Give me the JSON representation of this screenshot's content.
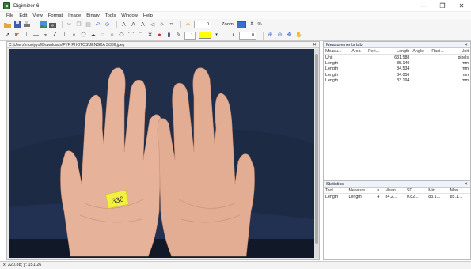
{
  "window": {
    "title": "Digimizer 6",
    "minimize": "—",
    "maximize": "❐",
    "close": "✕"
  },
  "menu": [
    "File",
    "Edit",
    "View",
    "Format",
    "Image",
    "Binary",
    "Tools",
    "Window",
    "Help"
  ],
  "toolbar": {
    "spin1_value": "0",
    "spin2_value": "0",
    "zoom_label": "Zoom:",
    "zoom_pct": "%",
    "spin3_value": "1",
    "spin4_value": "0"
  },
  "image_panel": {
    "path": "C:\\Users\\muniyyof\\Downloads\\FYP PHOTOS\\JENGKA 3\\336.jpeg",
    "close": "✕",
    "sticker_text": "336"
  },
  "measurements": {
    "title": "Measurements tab",
    "close": "✕",
    "columns": [
      "Measu...",
      "Area",
      "Peri...",
      "Length",
      "Angle",
      "Radi...",
      "Unit"
    ],
    "rows": [
      [
        "Unit",
        "",
        "",
        "631.588",
        "",
        "",
        "pixels"
      ],
      [
        "Length",
        "",
        "",
        "85.140",
        "",
        "",
        "mm"
      ],
      [
        "Length",
        "",
        "",
        "84.534",
        "",
        "",
        "mm"
      ],
      [
        "Length",
        "",
        "",
        "84.056",
        "",
        "",
        "mm"
      ],
      [
        "Length",
        "",
        "",
        "83.194",
        "",
        "",
        "mm"
      ]
    ]
  },
  "statistics": {
    "title": "Statistics",
    "close": "✕",
    "columns": [
      "Tool",
      "Measure",
      "n",
      "Mean",
      "SD",
      "Min",
      "Max"
    ],
    "rows": [
      [
        "Length",
        "Length",
        "4",
        "84.2...",
        "0.82...",
        "83.1...",
        "85.1..."
      ]
    ]
  },
  "status": {
    "coords": "x: 320.88; y: 151.26"
  }
}
